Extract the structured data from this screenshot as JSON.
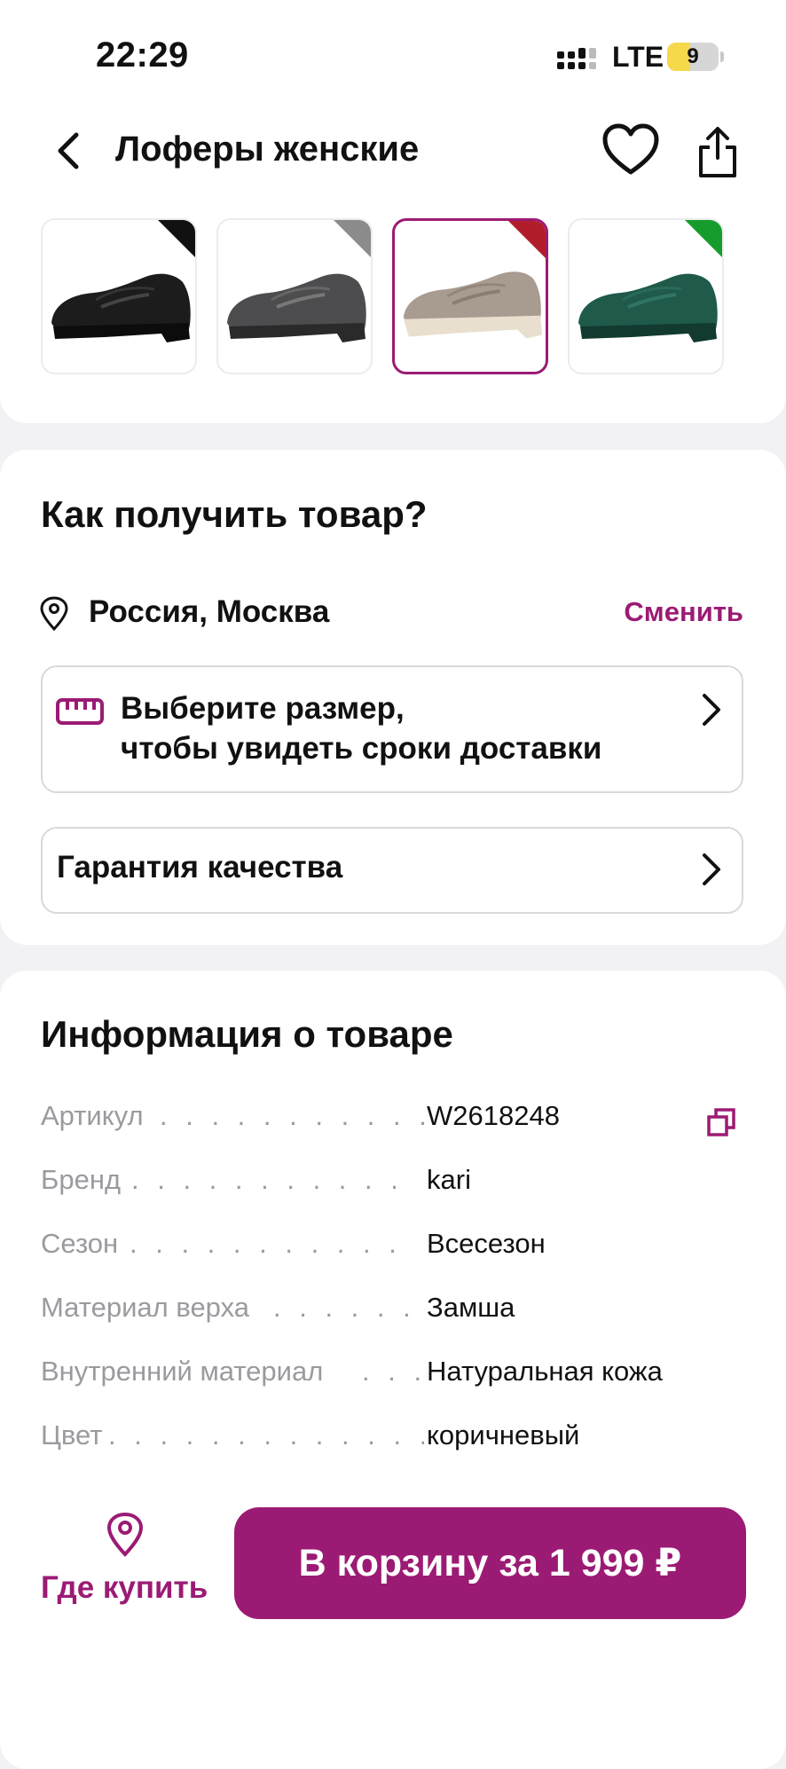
{
  "status_bar": {
    "time": "22:29",
    "network": "LTE",
    "battery": "9"
  },
  "header": {
    "title": "Лоферы женские"
  },
  "thumbnails": [
    {
      "color": "#111111",
      "label": "black"
    },
    {
      "color": "#8b8b8b",
      "label": "gray"
    },
    {
      "color": "#b11d2a",
      "label": "beige"
    },
    {
      "color": "#169c2c",
      "label": "green"
    }
  ],
  "delivery": {
    "title": "Как получить товар?",
    "location": "Россия, Москва",
    "change_label": "Сменить",
    "size_line1": "Выберите размер,",
    "size_line2": "чтобы увидеть сроки доставки",
    "quality_label": "Гарантия качества"
  },
  "info": {
    "title": "Информация о товаре",
    "rows": [
      {
        "label": "Артикул",
        "value": "W2618248"
      },
      {
        "label": "Бренд",
        "value": "kari"
      },
      {
        "label": "Сезон",
        "value": "Всесезон"
      },
      {
        "label": "Материал верха",
        "value": "Замша"
      },
      {
        "label": "Внутренний материал",
        "value": "Натуральная кожа"
      },
      {
        "label": "Цвет",
        "value": "коричневый"
      }
    ]
  },
  "bottom": {
    "where_label": "Где купить",
    "cart_label": "В корзину за 1 999 ₽"
  },
  "colors": {
    "accent": "#9b1b74"
  }
}
